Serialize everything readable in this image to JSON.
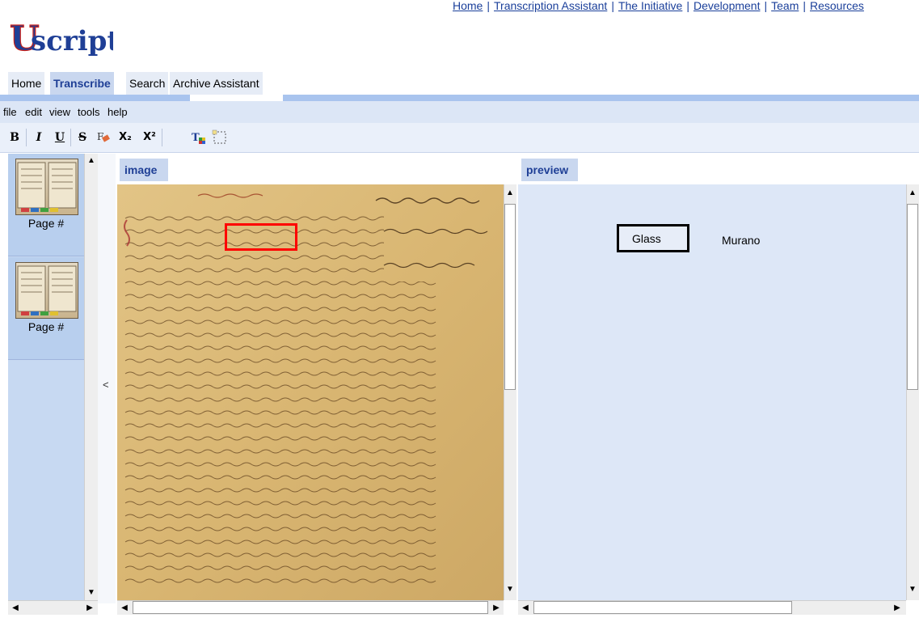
{
  "top_nav": {
    "links": [
      "Home",
      "Transcription Assistant",
      "The Initiative",
      "Development",
      "Team",
      "Resources"
    ],
    "separator": "|"
  },
  "logo": {
    "text": "Uscript",
    "color": "#1f3f96",
    "accent": "#c8201a"
  },
  "tabs": [
    "Home",
    "Transcribe",
    "Search",
    "Archive Assistant"
  ],
  "active_tab": "Transcribe",
  "menu": [
    "file",
    "edit",
    "view",
    "tools",
    "help"
  ],
  "toolbar": {
    "bold": "B",
    "italic": "I",
    "underline": "U",
    "strike": "S",
    "subscript": "X₂",
    "superscript": "X²",
    "icons": [
      "bold-icon",
      "italic-icon",
      "underline-icon",
      "strikethrough-icon",
      "eraser-icon",
      "subscript-icon",
      "superscript-icon",
      "text-format-icon",
      "select-region-icon"
    ]
  },
  "thumbnails": [
    {
      "label": "Page #"
    },
    {
      "label": "Page #"
    }
  ],
  "collapse_arrow": "<",
  "image_panel": {
    "title": "image"
  },
  "preview_panel": {
    "title": "preview",
    "boxed_word": "Glass",
    "word": "Murano"
  },
  "colors": {
    "tab_active_bg": "#c9d7ef",
    "tab_active_text": "#1f3f96",
    "strip": "#a9c4ee",
    "highlight_red": "#ff0000",
    "preview_bg": "#dde7f7"
  }
}
